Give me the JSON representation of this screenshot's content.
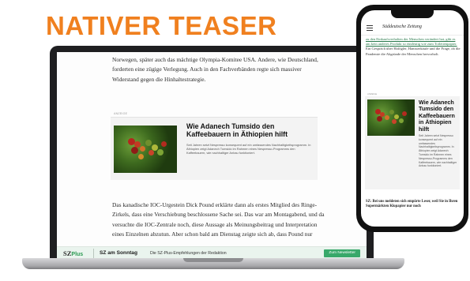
{
  "headline": "NATIVER TEASER",
  "laptop": {
    "article_top": "Norwegen, später auch das mächtige Olympia-Komitee USA. Andere, wie Deutschland, forderten eine zügige Verlegung. Auch in den Fachverbänden regte sich massiver Widerstand gegen die Hinhaltestrategie.",
    "anzeige": "ANZEIGE",
    "teaser_title": "Wie Adanech Tumsido den Kaffeebauern in Äthiopien hilft",
    "teaser_text": "Seit Jahren setzt Nespresso konsequent auf ein umfassendes Nachhaltigkeitsprogramm. In Äthiopien zeigt Adanech Tumsido im Rahmen eines Nespresso-Programms den Kaffeebauern, wie nachhaltiger Anbau funktioniert.",
    "article_bottom": "Das kanadische IOC-Urgestein Dick Pound erklärte dann als erstes Mitglied des Ringe-Zirkels, dass eine Verschiebung beschlossene Sache sei. Das war am Montagabend, und da versuchte die IOC-Zentrale noch, diese Aussage als Meinungsbeitrag und Interpretation eines Einzelnen abzutun. Aber schon bald am Dienstag zeigte sich ab, dass Pound nur",
    "bar": {
      "sz": "SZ",
      "plus": "Plus",
      "title": "SZ am Sonntag",
      "subtitle": "Die SZ-Plus-Empfehlungen der Redaktion",
      "button": "Zum Newsletter"
    }
  },
  "phone": {
    "logo": "Süddeutsche Zeitung",
    "article_link": "zu den Einkaufsverhalten der Menschen verändert hat, gibt es am kein anderes Produkt so eindeutig wie zum Toilettenpapier.",
    "article_rest": "Ein Gespräch über Hafögler, Hamsterkäufe und die Frage, ob die Pandemie die Abgründe der Menschen hervorholt.",
    "anzeige": "ANZEIGE",
    "teaser_title": "Wie Adanech Tumsido den Kaffeebauern in Äthiopien hilft",
    "teaser_text": "Seit Jahren setzt Nespresso konsequent auf ein umfassendes Nachhaltigkeitsprogramm. In Äthiopien zeigt Adanech Tumsido im Rahmen eines Nespresso-Programms den Kaffeebauern, wie nachhaltiger Anbau funktioniert.",
    "article_bottom": "SZ: Bei uns meldeten sich empörte Leser, weil Sie in Ihren Supermärkten Klopapier nur noch"
  },
  "colors": {
    "headline": "#f0801f",
    "accent_green": "#38a86a"
  }
}
